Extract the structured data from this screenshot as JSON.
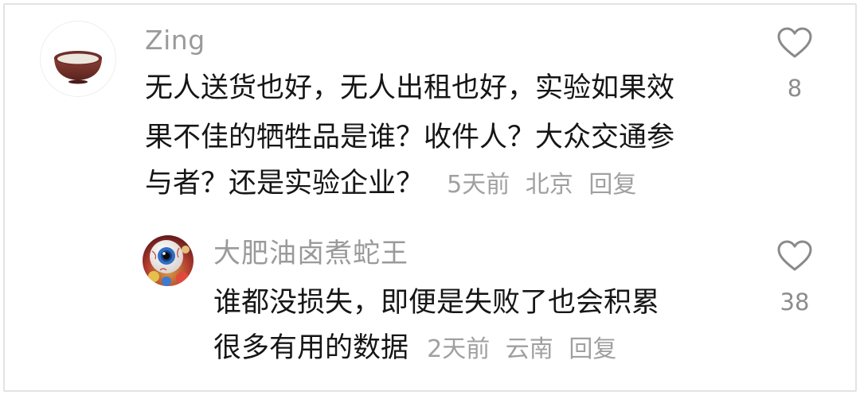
{
  "comments": [
    {
      "username": "Zing",
      "text_lines": [
        "无人送货也好，无人出租也好，实验如果效",
        "果不佳的牺牲品是谁？收件人？大众交通参",
        "与者？还是实验企业？"
      ],
      "time": "5天前",
      "location": "北京",
      "reply_label": "回复",
      "likes": "8",
      "avatar_icon": "teacup-bowl-avatar-icon",
      "like_icon": "heart-outline-icon"
    },
    {
      "username": "大肥油卤煮蛇王",
      "text_lines": [
        "谁都没损失，即便是失败了也会积累",
        "很多有用的数据"
      ],
      "time": "2天前",
      "location": "云南",
      "reply_label": "回复",
      "likes": "38",
      "avatar_icon": "eyeball-avatar-icon",
      "like_icon": "heart-outline-icon"
    }
  ],
  "colors": {
    "text": "#161616",
    "username": "#9a9a9a",
    "meta": "#a0a0a0",
    "icon": "#8a8a8a",
    "border": "#e3e3e3"
  }
}
